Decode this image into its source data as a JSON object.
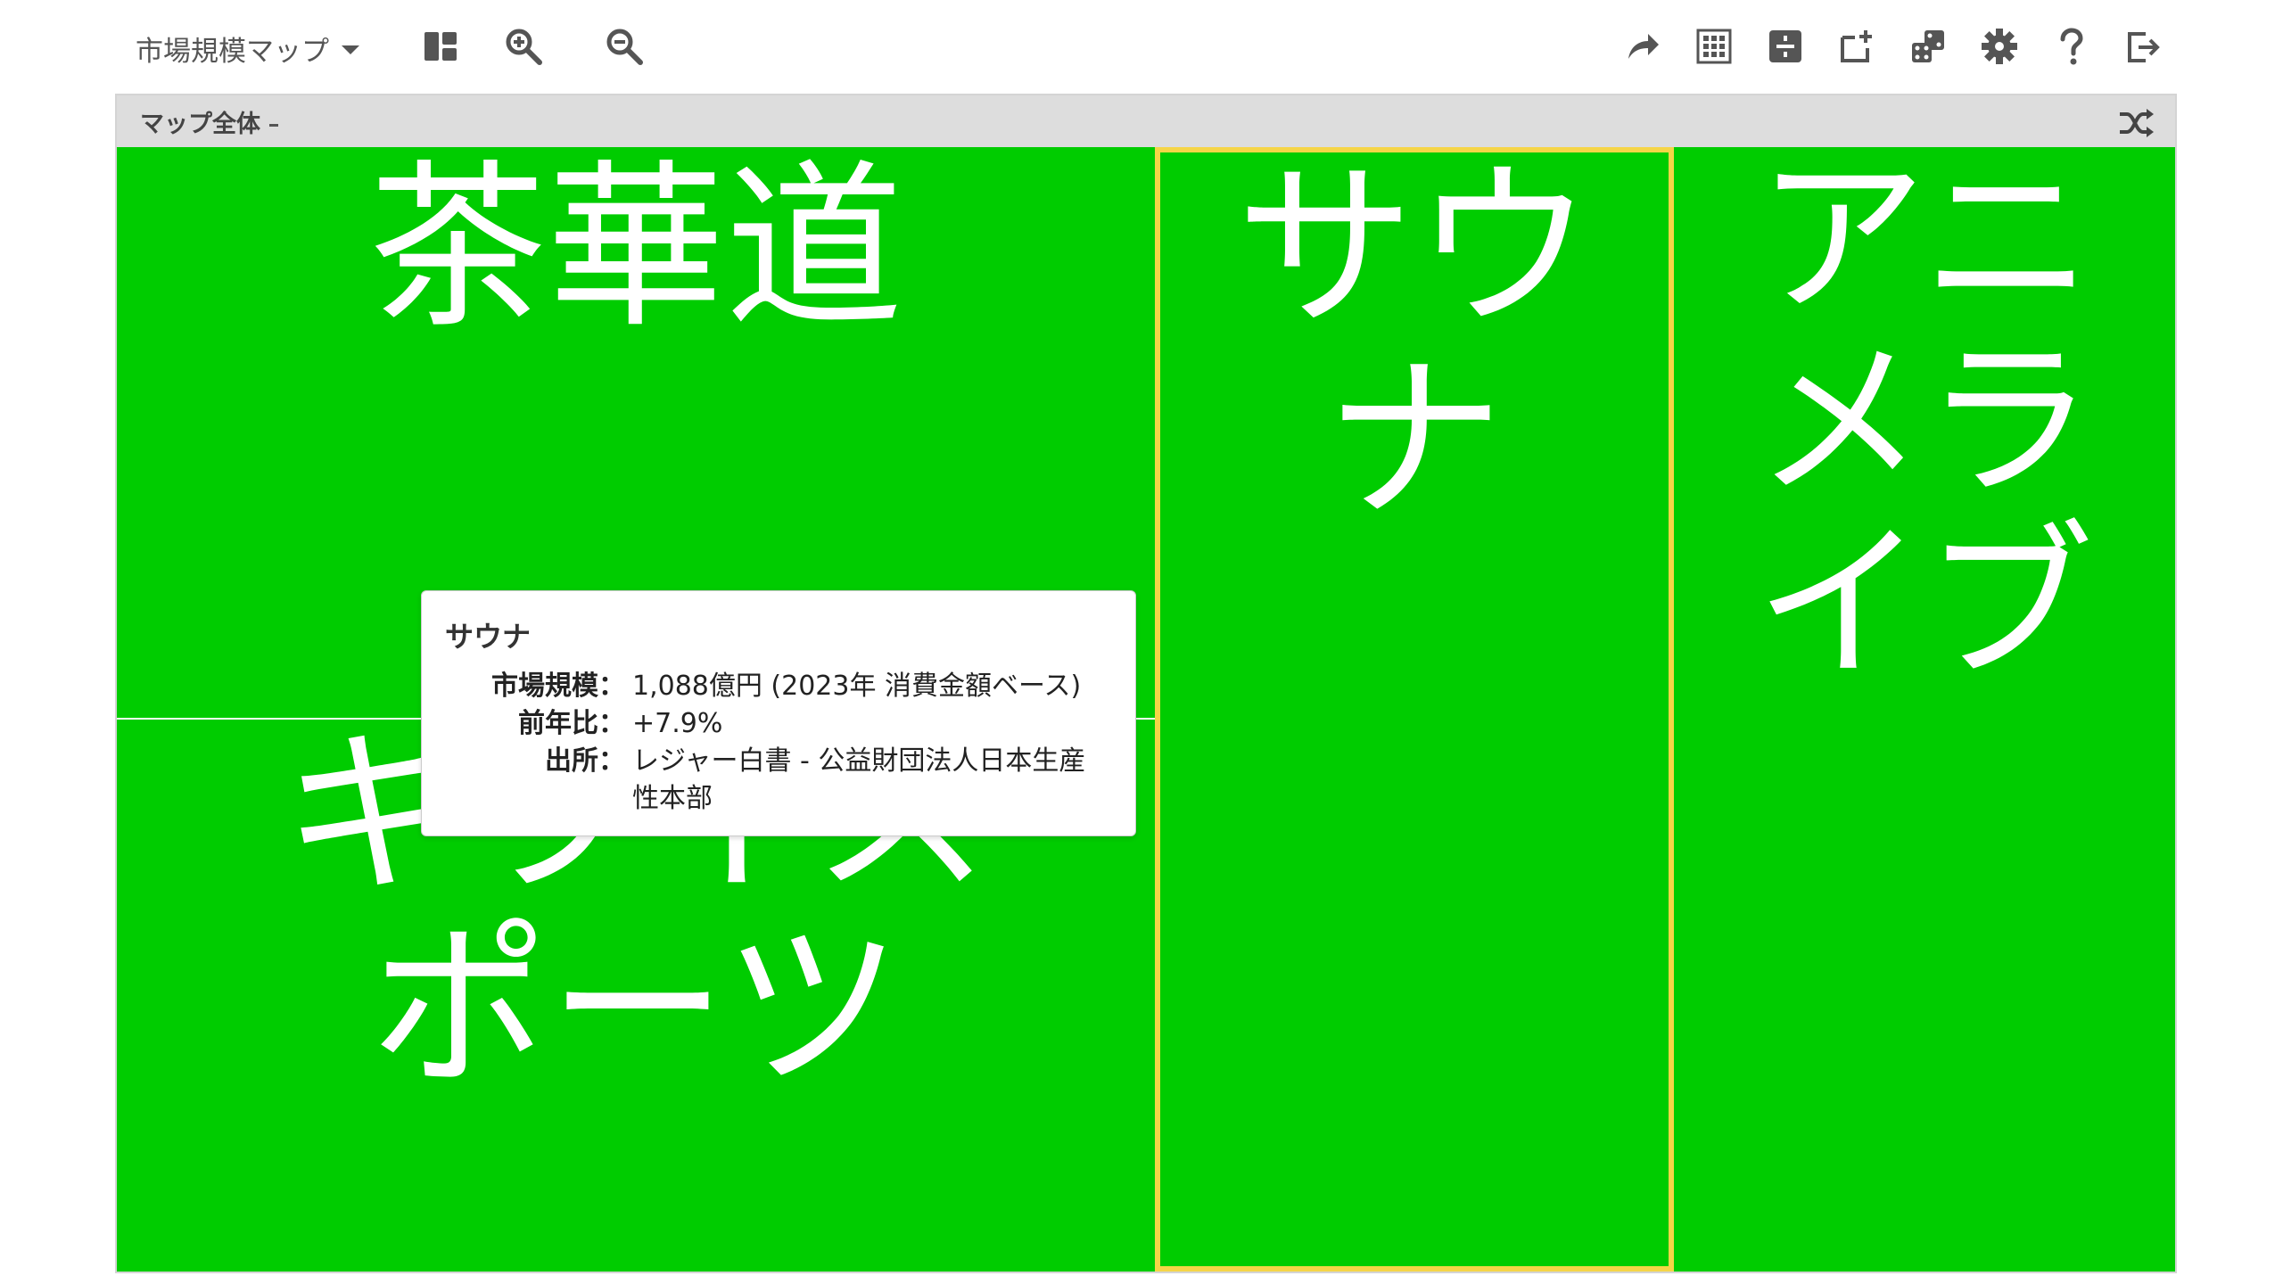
{
  "toolbar": {
    "map_title": "市場規模マップ",
    "icons": [
      "layout-icon",
      "zoom-in-icon",
      "zoom-out-icon",
      "share-icon",
      "grid-icon",
      "split-icon",
      "add-window-icon",
      "dice-icon",
      "gear-icon",
      "help-icon",
      "logout-icon"
    ]
  },
  "map": {
    "scope_label": "マップ全体",
    "tiles": [
      {
        "label": "茶華道",
        "color": "#00cc00"
      },
      {
        "label": "キウイスポーツ",
        "color": "#00cc00"
      },
      {
        "label": "サウナ",
        "color": "#00cc00",
        "selected": true
      },
      {
        "label": "アニメライブ",
        "color": "#00cc00"
      }
    ],
    "highlight_color": "#f5d547"
  },
  "tooltip": {
    "title": "サウナ",
    "rows": [
      {
        "key": "市場規模：",
        "value": "1,088億円 (2023年 消費金額ベース)"
      },
      {
        "key": "前年比：",
        "value": "+7.9%"
      },
      {
        "key": "出所：",
        "value": "レジャー白書 - 公益財団法人日本生産性本部"
      }
    ]
  }
}
